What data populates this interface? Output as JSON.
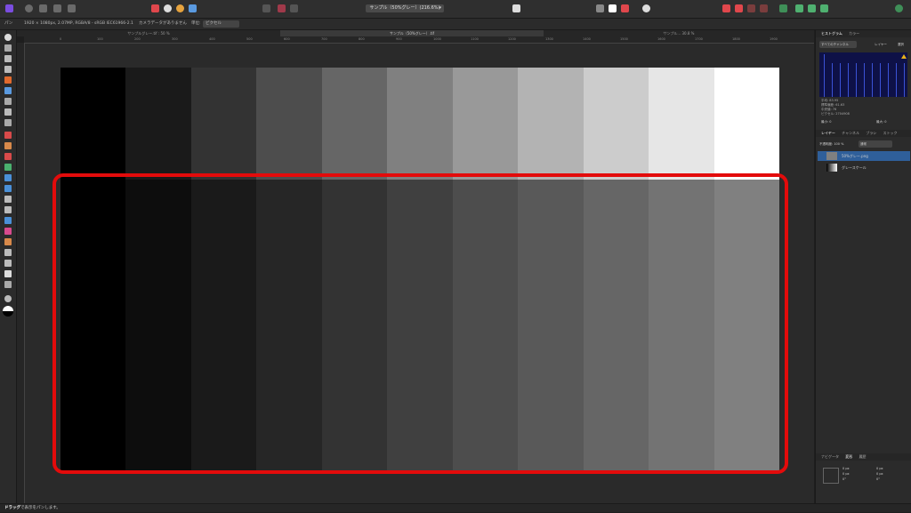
{
  "window": {
    "document_title": "サンプル（50%グレー）(216.6%)",
    "tabs": [
      "サンプルグレー.tif : 50 %",
      "サンプル（50%グレー）.tif",
      "サンプル... 30.8 %"
    ]
  },
  "context_bar": {
    "doc_info": "1920 × 1080px, 2.07MP, RGBA/8 - sRGB IEC61966-2.1",
    "camera_data": "カメラデータがありません",
    "unit_label": "単位:",
    "unit_value": "ピクセル"
  },
  "ruler": {
    "h_ticks": [
      "0",
      "100",
      "200",
      "300",
      "400",
      "500",
      "600",
      "700",
      "800",
      "900",
      "1000",
      "1100",
      "1200",
      "1300",
      "1400",
      "1500",
      "1600",
      "1700",
      "1800",
      "1900"
    ]
  },
  "image": {
    "top_row": [
      "#000000",
      "#1a1a1a",
      "#333333",
      "#4d4d4d",
      "#666666",
      "#808080",
      "#999999",
      "#b3b3b3",
      "#cccccc",
      "#e6e6e6",
      "#ffffff"
    ],
    "bottom_row": [
      "#000000",
      "#0d0d0d",
      "#1a1a1a",
      "#262626",
      "#333333",
      "#404040",
      "#4d4d4d",
      "#595959",
      "#666666",
      "#737373",
      "#808080"
    ]
  },
  "highlight_color": "#e30b0b",
  "histogram_panel": {
    "tabs": [
      "ヒストグラム",
      "カラー"
    ],
    "channel": "すべてのチャンネル",
    "layer_label": "レイヤー",
    "selection_label": "選択",
    "stats": [
      "平均: 83.95",
      "標準偏差: 61.63",
      "中央値: 76",
      "ピクセル: 2704908"
    ],
    "min_label": "最小: 0",
    "max_label": "最大: 0"
  },
  "layers_panel": {
    "tabs": [
      "レイヤー",
      "チャンネル",
      "ブラシ",
      "ストック"
    ],
    "opacity_label": "不透明度:",
    "opacity_value": "100 %",
    "blend_mode": "通常",
    "layers": [
      {
        "name": "50%グレー.png",
        "selected": true
      },
      {
        "name": "グレースケール",
        "selected": false
      }
    ]
  },
  "transform_panel": {
    "tabs": [
      "ナビゲータ",
      "変形",
      "履歴"
    ],
    "x": "0 px",
    "y": "0 px",
    "w": "0 px",
    "h": "0 px",
    "r": "0°",
    "s": "0°"
  },
  "status": {
    "bold": "ドラッグ",
    "text": "で表示をパンします。"
  }
}
